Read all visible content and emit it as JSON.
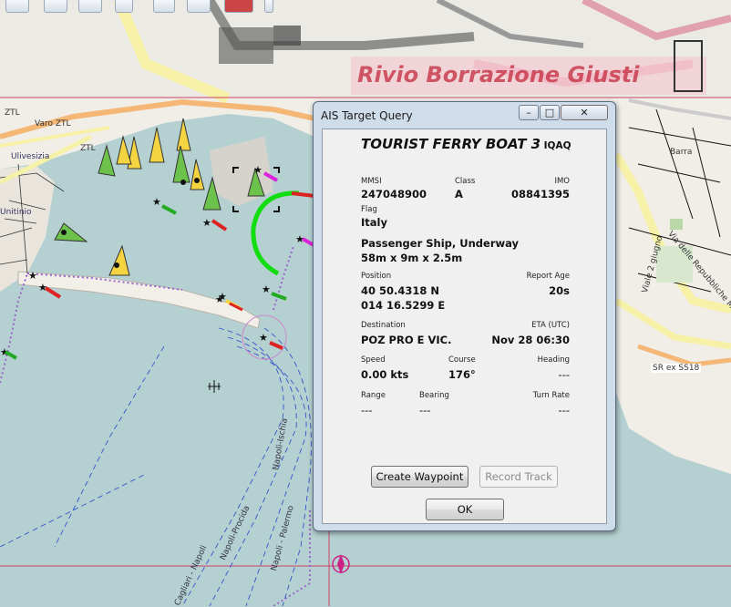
{
  "dialog": {
    "title": "AIS Target Query",
    "caption_buttons": {
      "minimize": "–",
      "maximize": "□",
      "close": "✕"
    },
    "vessel_name": "TOURIST FERRY BOAT 3",
    "callsign": "IQAQ",
    "mmsi_label": "MMSI",
    "mmsi": "247048900",
    "class_label": "Class",
    "class_value": "A",
    "imo_label": "IMO",
    "imo": "08841395",
    "flag_label": "Flag",
    "flag": "Italy",
    "ship_type": "Passenger Ship, Underway",
    "dimensions": "58m x 9m x 2.5m",
    "position_label": "Position",
    "lat": "40 50.4318 N",
    "lon": "014 16.5299 E",
    "report_age_label": "Report Age",
    "report_age": "20s",
    "destination_label": "Destination",
    "destination": "POZ PRO E VIC.",
    "eta_label": "ETA (UTC)",
    "eta": "Nov 28 06:30",
    "speed_label": "Speed",
    "speed": "0.00 kts",
    "course_label": "Course",
    "course": "176°",
    "heading_label": "Heading",
    "heading": "---",
    "range_label": "Range",
    "range": "---",
    "bearing_label": "Bearing",
    "bearing": "---",
    "turn_rate_label": "Turn Rate",
    "turn_rate": "---",
    "create_waypoint": "Create Waypoint",
    "record_track": "Record Track",
    "ok": "OK"
  },
  "map_labels": {
    "ztl_1": "ZTL",
    "ztl_2": "Varo ZTL",
    "ztl_3": "ZTL",
    "street_1": "Ulivesizia",
    "street_2": "Unitinio",
    "barra": "Barra",
    "via_2_giugno": "Viale 2 giugno",
    "via_repubbliche": "Via delle Repubbliche Marinare",
    "sr_ss18": "SR ex SS18",
    "napoli_ischia": "Napoli-Ischia",
    "napoli_palermo": "Napoli - Palermo",
    "napoli_procida": "Napoli-Procida",
    "cagliari_napoli": "Cagliari - Napoli",
    "header_text": "Rivio Borrazione Giusti"
  },
  "colors": {
    "sea": "#b5d0d0",
    "land": "#f1eee8",
    "ais_class_a": "#f5d442",
    "ais_moored": "#6cc24a",
    "dialog_frame": "#cfdcea"
  }
}
